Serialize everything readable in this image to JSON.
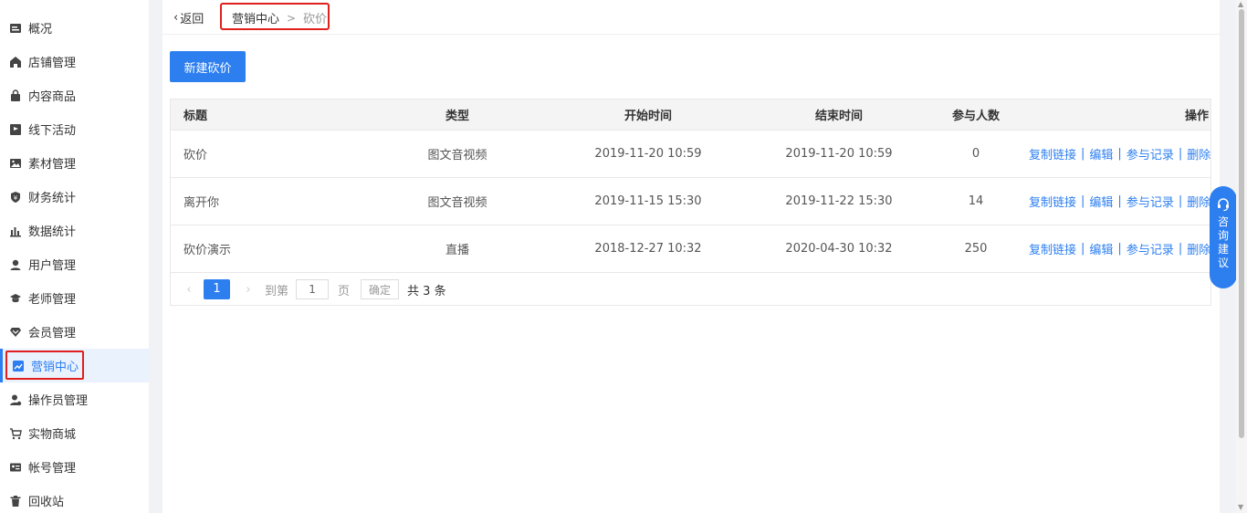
{
  "sidebar": {
    "items": [
      {
        "label": "概况",
        "icon": "overview-icon"
      },
      {
        "label": "店铺管理",
        "icon": "shop-icon"
      },
      {
        "label": "内容商品",
        "icon": "bag-icon"
      },
      {
        "label": "线下活动",
        "icon": "flag-icon"
      },
      {
        "label": "素材管理",
        "icon": "image-icon"
      },
      {
        "label": "财务统计",
        "icon": "yuan-icon"
      },
      {
        "label": "数据统计",
        "icon": "bar-chart-icon"
      },
      {
        "label": "用户管理",
        "icon": "user-icon"
      },
      {
        "label": "老师管理",
        "icon": "graduation-cap-icon"
      },
      {
        "label": "会员管理",
        "icon": "vip-icon"
      },
      {
        "label": "营销中心",
        "icon": "trend-icon"
      },
      {
        "label": "操作员管理",
        "icon": "operator-icon"
      },
      {
        "label": "实物商城",
        "icon": "cart-icon"
      },
      {
        "label": "帐号管理",
        "icon": "id-card-icon"
      },
      {
        "label": "回收站",
        "icon": "trash-icon"
      }
    ]
  },
  "topbar": {
    "back_label": "返回",
    "breadcrumb": [
      "营销中心",
      "砍价"
    ],
    "breadcrumb_sep": ">"
  },
  "toolbar": {
    "new_button": "新建砍价"
  },
  "table": {
    "headers": [
      "标题",
      "类型",
      "开始时间",
      "结束时间",
      "参与人数",
      "操作"
    ],
    "rows": [
      {
        "title": "砍价",
        "type": "图文音视频",
        "start": "2019-11-20 10:59",
        "end": "2019-11-20 10:59",
        "count": "0"
      },
      {
        "title": "离开你",
        "type": "图文音视频",
        "start": "2019-11-15 15:30",
        "end": "2019-11-22 15:30",
        "count": "14"
      },
      {
        "title": "砍价演示",
        "type": "直播",
        "start": "2018-12-27 10:32",
        "end": "2020-04-30 10:32",
        "count": "250"
      }
    ],
    "actions": [
      "复制链接",
      "编辑",
      "参与记录",
      "删除"
    ],
    "action_sep": "|"
  },
  "pagination": {
    "current_page": "1",
    "goto_label": "到第",
    "goto_value": "1",
    "page_label": "页",
    "confirm_label": "确定",
    "total_label": "共 3 条"
  },
  "consult": {
    "label": "咨询建议"
  },
  "colors": {
    "accent": "#2d7ff0",
    "highlight_border": "#e0201d"
  }
}
